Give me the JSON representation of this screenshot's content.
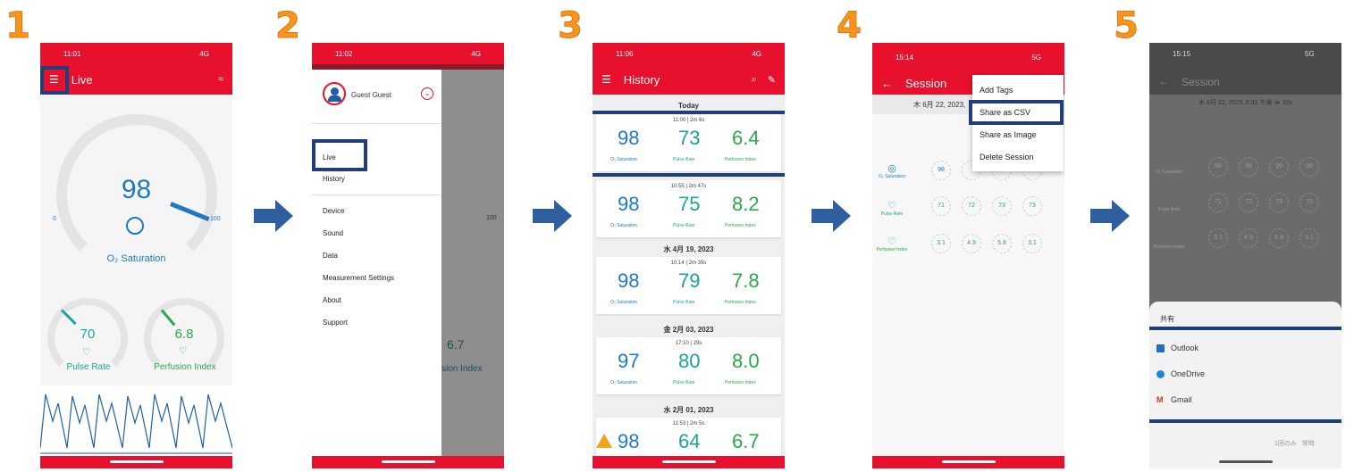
{
  "steps": [
    "1",
    "2",
    "3",
    "4",
    "5"
  ],
  "colors": {
    "brand": "#e8112d",
    "highlight": "#1f3f7a",
    "step": "#f7941d",
    "arrow": "#2f5f9e"
  },
  "phone1": {
    "status_time": "11:01",
    "status_right": "4G",
    "title": "Live",
    "big_value": "98",
    "gauge_min": "0",
    "gauge_max": "100",
    "o2_label": "O₂ Saturation",
    "pulse_value": "70",
    "pulse_label": "Pulse Rate",
    "pi_value": "6.8",
    "pi_label": "Perfusion Index"
  },
  "phone2": {
    "status_time": "11:02",
    "status_right": "4G",
    "user": "Guest Guest",
    "menu": [
      "Live",
      "History",
      "Device",
      "Sound",
      "Data",
      "Measurement Settings",
      "About",
      "Support"
    ],
    "behind_value": "6.7",
    "behind_label": "sion Index",
    "behind_max": "100"
  },
  "phone3": {
    "status_time": "11:06",
    "status_right": "4G",
    "title": "History",
    "sections": [
      {
        "date": "Today",
        "cards": [
          {
            "time": "11:00 | 2m 6s",
            "o2": "98",
            "pr": "73",
            "pi": "6.4"
          },
          {
            "time": "10:55 | 2m 47s",
            "o2": "98",
            "pr": "75",
            "pi": "8.2"
          }
        ]
      },
      {
        "date": "水 4月 19, 2023",
        "cards": [
          {
            "time": "10:14 | 2m 39s",
            "o2": "98",
            "pr": "79",
            "pi": "7.8"
          }
        ]
      },
      {
        "date": "金 2月 03, 2023",
        "cards": [
          {
            "time": "17:10 | 29s",
            "o2": "97",
            "pr": "80",
            "pi": "8.0"
          }
        ]
      },
      {
        "date": "水 2月 01, 2023",
        "cards": [
          {
            "time": "11:53 | 2m 5s",
            "o2": "98",
            "pr": "64",
            "pi": "6.7"
          }
        ]
      }
    ],
    "lbl_o2": "O₂ Saturation",
    "lbl_pr": "Pulse Rate",
    "lbl_pi": "Perfusion Index"
  },
  "phone4": {
    "status_time": "15:14",
    "status_right": "5G",
    "title": "Session",
    "date_line": "木 6月 22, 2023,",
    "popup": [
      "Add Tags",
      "Share as CSV",
      "Share as Image",
      "Delete Session"
    ],
    "rows": [
      {
        "label": "O₂ Saturation",
        "values": [
          "98",
          "",
          "",
          ""
        ]
      },
      {
        "label": "Pulse Rate",
        "values": [
          "71",
          "72",
          "73",
          "73"
        ]
      },
      {
        "label": "Perfusion Index",
        "values": [
          "3.1",
          "4.9",
          "5.8",
          "3.1"
        ]
      }
    ]
  },
  "phone5": {
    "status_time": "15:15",
    "status_right": "5G",
    "title": "Session",
    "date_line": "木 6月 22, 2023, 6:31 午後 ≫ 32s",
    "sheet_title": "共有",
    "share_options": [
      "Outlook",
      "OneDrive",
      "Gmail"
    ],
    "footer_a": "1回のみ",
    "footer_b": "常時",
    "rows": [
      {
        "label": "O₂ Saturation",
        "values": [
          "98",
          "98",
          "99",
          "98"
        ]
      },
      {
        "label": "Pulse Rate",
        "values": [
          "71",
          "72",
          "73",
          "73"
        ]
      },
      {
        "label": "Perfusion Index",
        "values": [
          "3.1",
          "4.9",
          "5.8",
          "3.1"
        ]
      }
    ]
  }
}
